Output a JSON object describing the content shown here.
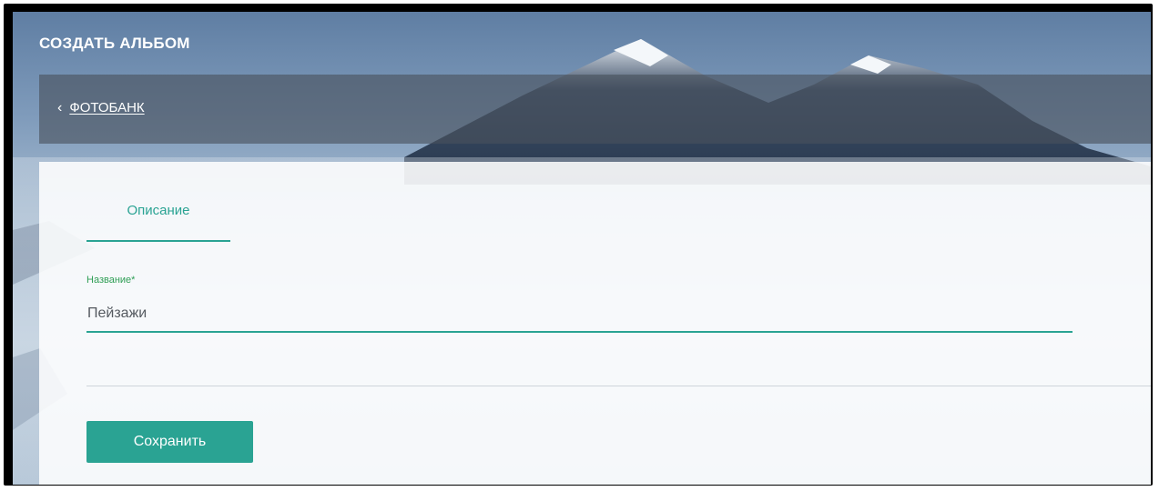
{
  "header": {
    "title": "СОЗДАТЬ АЛЬБОМ"
  },
  "breadcrumb": {
    "back_icon": "chevron-left-icon",
    "link_label": "ФОТОБАНК"
  },
  "tabs": [
    {
      "label": "Описание",
      "active": true
    }
  ],
  "form": {
    "name_label": "Название",
    "required_mark": "*",
    "name_value": "Пейзажи",
    "save_label": "Сохранить"
  },
  "colors": {
    "accent": "#2aa393",
    "label_green": "#2f9e55",
    "overlay_bar": "#48505c",
    "card": "#ffffff"
  }
}
